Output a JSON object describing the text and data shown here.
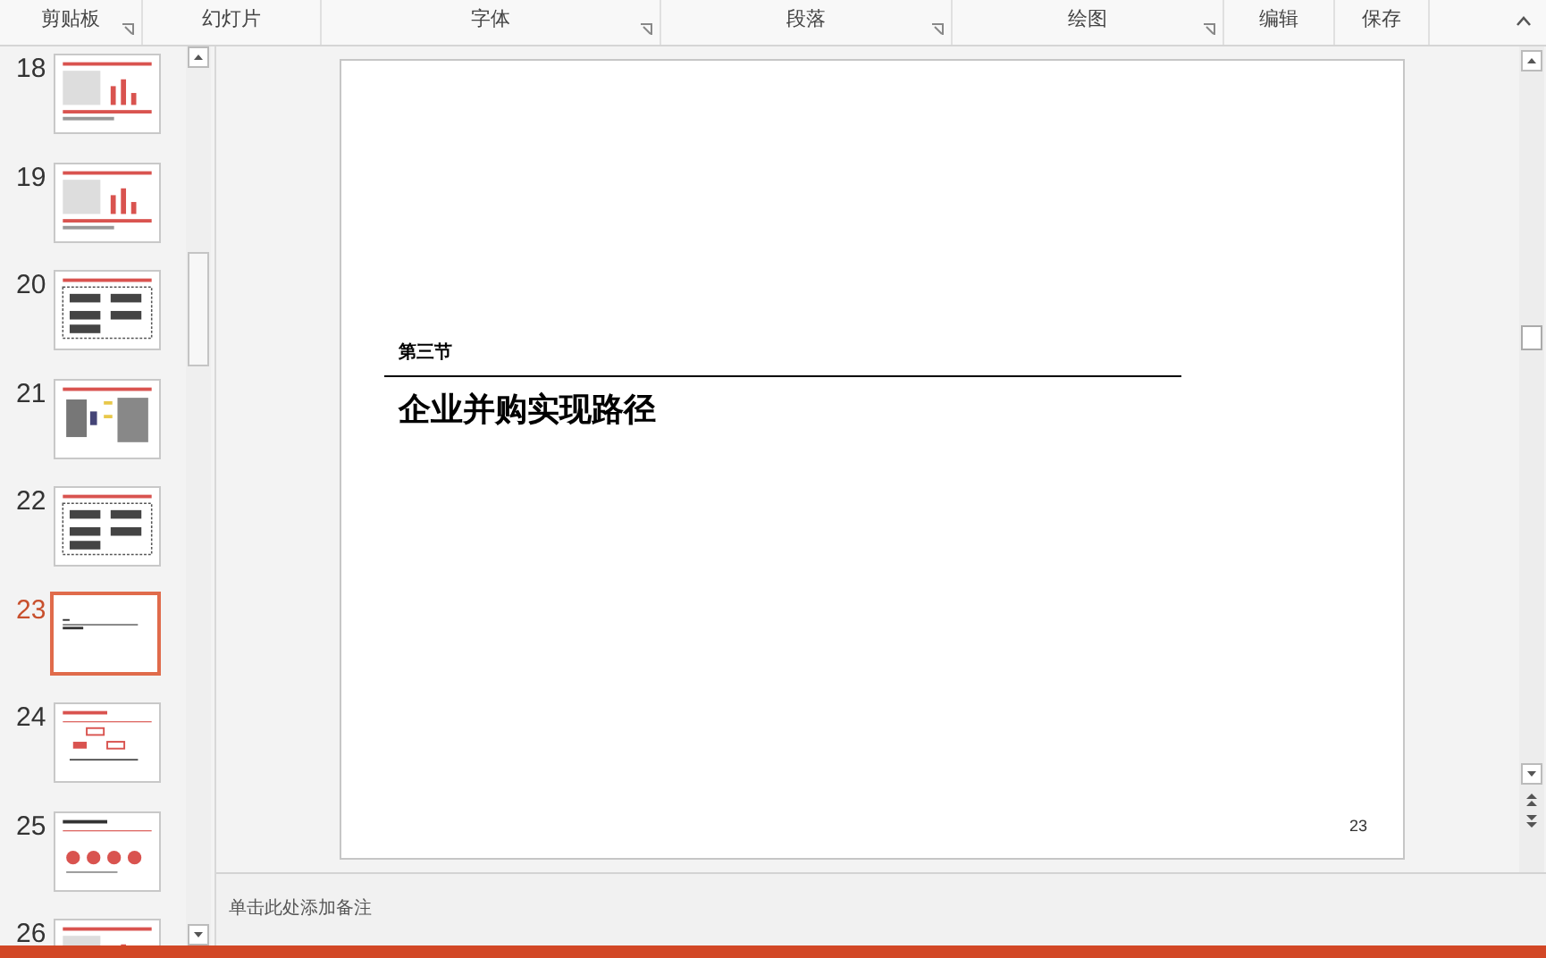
{
  "ribbon": {
    "groups": [
      {
        "label": "剪贴板",
        "launcher": true
      },
      {
        "label": "幻灯片",
        "launcher": false
      },
      {
        "label": "字体",
        "launcher": true
      },
      {
        "label": "段落",
        "launcher": true
      },
      {
        "label": "绘图",
        "launcher": true
      },
      {
        "label": "编辑",
        "launcher": false
      },
      {
        "label": "保存",
        "launcher": false
      }
    ]
  },
  "thumbnails": [
    {
      "number": "18",
      "kind": "chart",
      "selected": false
    },
    {
      "number": "19",
      "kind": "chart",
      "selected": false
    },
    {
      "number": "20",
      "kind": "table",
      "selected": false
    },
    {
      "number": "21",
      "kind": "list",
      "selected": false
    },
    {
      "number": "22",
      "kind": "table",
      "selected": false
    },
    {
      "number": "23",
      "kind": "title",
      "selected": true
    },
    {
      "number": "24",
      "kind": "diagram",
      "selected": false
    },
    {
      "number": "25",
      "kind": "circles",
      "selected": false
    },
    {
      "number": "26",
      "kind": "chart",
      "selected": false
    }
  ],
  "slide": {
    "section": "第三节",
    "title": "企业并购实现路径",
    "page_number": "23"
  },
  "notes": {
    "placeholder": "单击此处添加备注"
  }
}
